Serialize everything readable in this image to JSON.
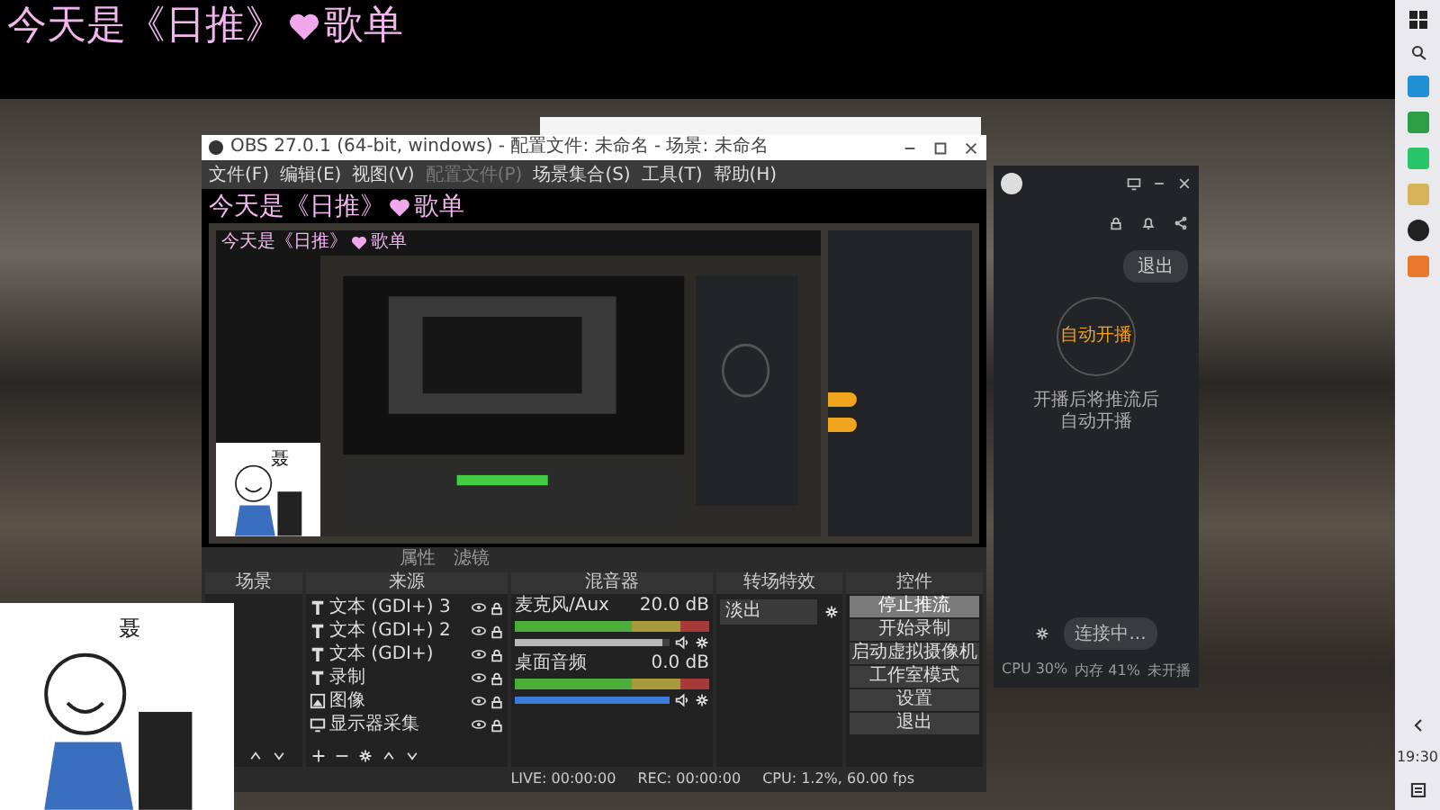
{
  "overlay_title": {
    "text": "今天是《日推》",
    "suffix": "歌单"
  },
  "obs": {
    "title": "OBS 27.0.1 (64-bit, windows) - 配置文件: 未命名 - 场景: 未命名",
    "menu": [
      {
        "label": "文件(F)",
        "disabled": false
      },
      {
        "label": "编辑(E)",
        "disabled": false
      },
      {
        "label": "视图(V)",
        "disabled": false
      },
      {
        "label": "配置文件(P)",
        "disabled": true
      },
      {
        "label": "场景集合(S)",
        "disabled": false
      },
      {
        "label": "工具(T)",
        "disabled": false
      },
      {
        "label": "帮助(H)",
        "disabled": false
      }
    ],
    "preview": {
      "caption": "今天是《日推》",
      "caption_suffix": "歌单",
      "nested_caption": "今天是《日推》",
      "nested_suffix": "歌单"
    },
    "source_toolbar": [
      "属性",
      "滤镜"
    ],
    "docks": [
      "场景",
      "来源",
      "混音器",
      "转场特效",
      "控件"
    ],
    "sources": [
      {
        "name": "文本 (GDI+) 3",
        "kind": "text"
      },
      {
        "name": "文本 (GDI+) 2",
        "kind": "text"
      },
      {
        "name": "文本 (GDI+)",
        "kind": "text"
      },
      {
        "name": "录制",
        "kind": "text"
      },
      {
        "name": "图像",
        "kind": "image"
      },
      {
        "name": "显示器采集",
        "kind": "display"
      }
    ],
    "mixer": [
      {
        "name": "麦克风/Aux",
        "reading": "20.0 dB",
        "level": 0.95
      },
      {
        "name": "桌面音频",
        "reading": "0.0 dB",
        "level": 1.0
      }
    ],
    "transition": {
      "value": "淡出"
    },
    "controls": [
      {
        "label": "停止推流",
        "active": true
      },
      {
        "label": "开始录制",
        "active": false
      },
      {
        "label": "启动虚拟摄像机",
        "active": false
      },
      {
        "label": "工作室模式",
        "active": false
      },
      {
        "label": "设置",
        "active": false
      },
      {
        "label": "退出",
        "active": false
      }
    ],
    "status": {
      "live": "LIVE: 00:00:00",
      "rec": "REC: 00:00:00",
      "cpu": "CPU: 1.2%, 60.00 fps"
    }
  },
  "stream_app": {
    "exit_button": "退出",
    "auto_start": "自动开播",
    "hint_lines": [
      "开播后将推流后",
      "自动开播"
    ],
    "connect_button": "连接中...",
    "status": [
      "CPU 30%",
      "内存 41%",
      "未开播"
    ]
  },
  "cartoons": [
    {
      "label": "聂"
    },
    {
      "label": "聂"
    }
  ],
  "taskbar": {
    "time": "19:30"
  }
}
